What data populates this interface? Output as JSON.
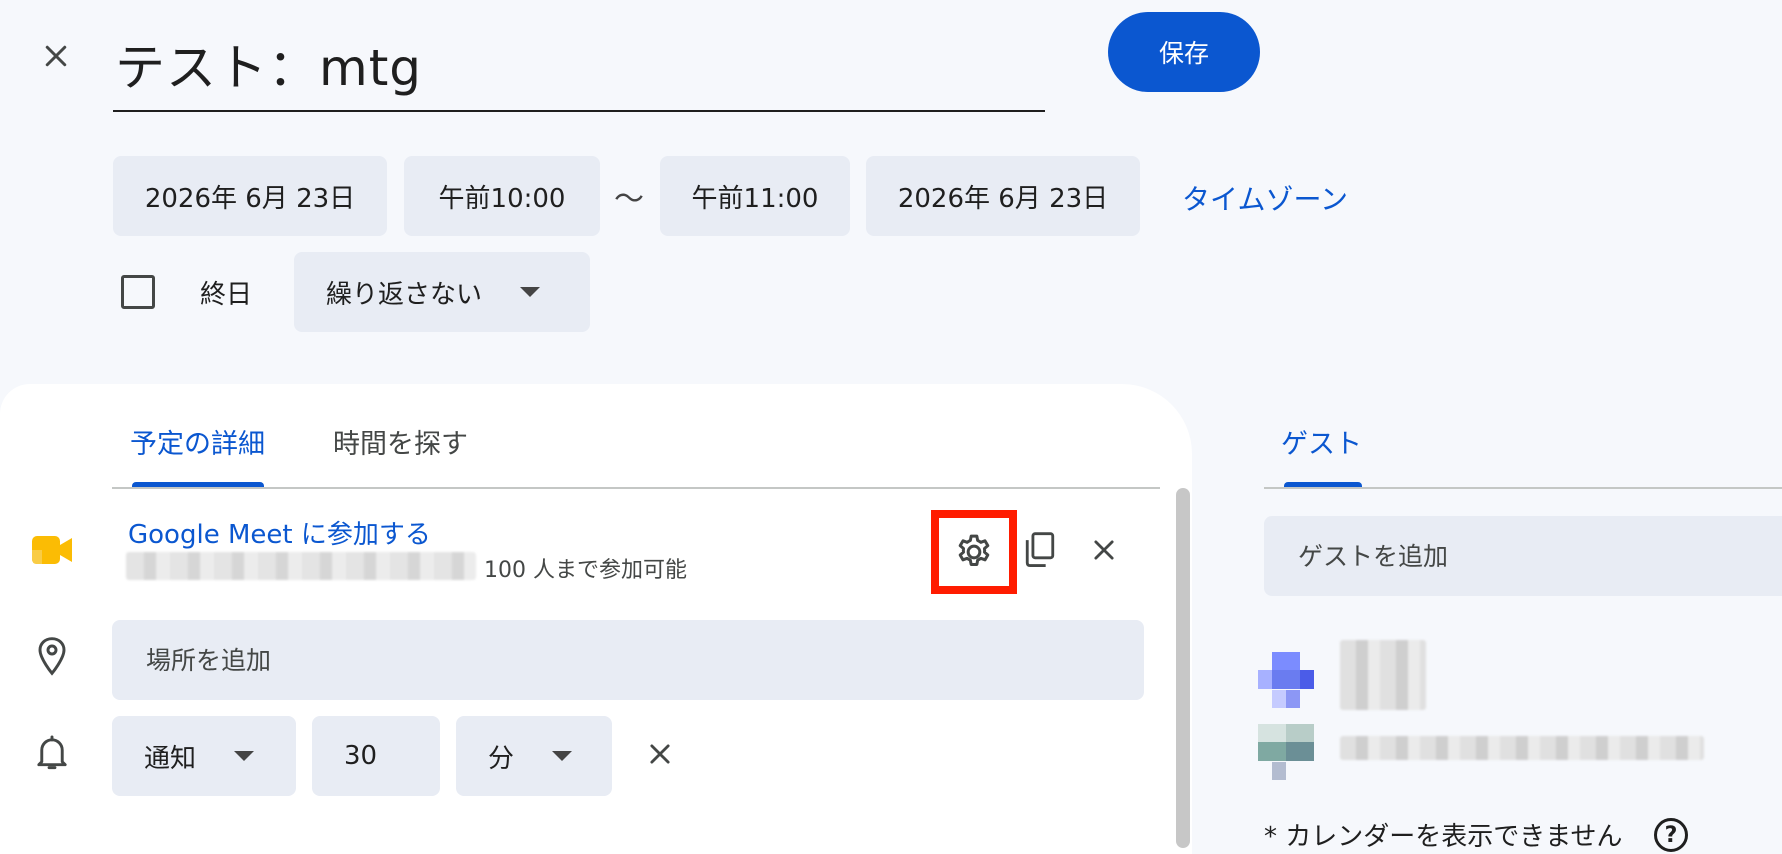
{
  "header": {
    "title": "テスト：mtg",
    "save_label": "保存"
  },
  "datetime": {
    "start_date": "2026年 6月 23日",
    "start_time": "午前10:00",
    "separator": "〜",
    "end_time": "午前11:00",
    "end_date": "2026年 6月 23日",
    "timezone_link": "タイムゾーン",
    "all_day_label": "終日",
    "all_day_checked": false,
    "repeat_value": "繰り返さない"
  },
  "tabs": {
    "details": "予定の詳細",
    "find_time": "時間を探す"
  },
  "meet": {
    "link_label": "Google Meet に参加する",
    "capacity_text": "100 人まで参加可能",
    "accent_color": "#fbbc04",
    "settings_highlight_color": "#ff1c00"
  },
  "location": {
    "placeholder": "場所を追加"
  },
  "notification": {
    "type": "通知",
    "amount": "30",
    "unit": "分"
  },
  "guests": {
    "tab_label": "ゲスト",
    "input_placeholder": "ゲストを追加",
    "calendar_note": "* カレンダーを表示できません"
  },
  "colors": {
    "primary": "#0b57d0",
    "chip_bg": "#e8ecf4",
    "page_bg": "#f6f8fc"
  }
}
